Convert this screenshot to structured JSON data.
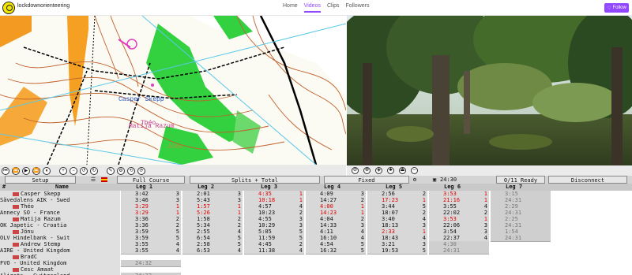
{
  "topbar": {
    "channel": "lockdownorienteering",
    "nav": [
      "Home",
      "Videos",
      "Clips",
      "Followers"
    ],
    "active_nav": "Videos",
    "follow_label": "Follow",
    "accent": "#9147ff"
  },
  "map": {
    "labels": [
      "Casper Skepp",
      "Théo",
      "Matija Razum",
      "Jönu"
    ],
    "controls": [
      "first",
      "rewind",
      "play",
      "fast-forward",
      "pause",
      "zoom-in",
      "zoom-out",
      "rotate-left",
      "rotate-right",
      "pen",
      "settings",
      "refresh",
      "redo"
    ]
  },
  "results": {
    "setup_label": "Setup",
    "course_label": "Full Course",
    "mode_label": "Splits + Total",
    "fixed_label": "Fixed",
    "clock": "24:30",
    "ready_label": "0/11 Ready",
    "disconnect_label": "Disconnect",
    "headers": [
      "#",
      "Name",
      "Leg 1",
      "Leg 2",
      "Leg 3",
      "Leg 4",
      "Leg 5",
      "Leg 6",
      "Leg 7"
    ],
    "rows": [
      {
        "name": "Casper Skepp",
        "flag": true,
        "legs": [
          [
            "3:42",
            "3"
          ],
          [
            "2:01",
            "3"
          ],
          [
            "4:35",
            "1"
          ],
          [
            "4:09",
            "3"
          ],
          [
            "2:56",
            "2"
          ],
          [
            "3:53",
            "1"
          ],
          [
            "3:15",
            ""
          ]
        ],
        "red": [
          2,
          5
        ],
        "grey": [
          6
        ]
      },
      {
        "name": "Sävedalens AIK - Swed",
        "flag": false,
        "legs": [
          [
            "3:46",
            "3"
          ],
          [
            "5:43",
            "3"
          ],
          [
            "10:18",
            "1"
          ],
          [
            "14:27",
            "2"
          ],
          [
            "17:23",
            "1"
          ],
          [
            "21:16",
            "1"
          ],
          [
            "24:31",
            ""
          ]
        ],
        "red": [
          2,
          4,
          5
        ],
        "grey": [
          6
        ]
      },
      {
        "name": "Théo",
        "flag": true,
        "legs": [
          [
            "3:29",
            "1"
          ],
          [
            "1:57",
            "1"
          ],
          [
            "4:57",
            "4"
          ],
          [
            "4:00",
            "1"
          ],
          [
            "3:44",
            "5"
          ],
          [
            "3:55",
            "4"
          ],
          [
            "2:29",
            ""
          ]
        ],
        "red": [
          0,
          1,
          3
        ],
        "grey": [
          6
        ]
      },
      {
        "name": "Annecy SO - France",
        "flag": false,
        "legs": [
          [
            "3:29",
            "1"
          ],
          [
            "5:26",
            "1"
          ],
          [
            "10:23",
            "2"
          ],
          [
            "14:23",
            "1"
          ],
          [
            "18:07",
            "2"
          ],
          [
            "22:02",
            "2"
          ],
          [
            "24:31",
            ""
          ]
        ],
        "red": [
          0,
          1,
          3
        ],
        "grey": [
          6
        ]
      },
      {
        "name": "Matija Razum",
        "flag": true,
        "legs": [
          [
            "3:36",
            "2"
          ],
          [
            "1:58",
            "2"
          ],
          [
            "4:55",
            "3"
          ],
          [
            "4:04",
            "2"
          ],
          [
            "3:40",
            "4"
          ],
          [
            "3:53",
            "1"
          ],
          [
            "2:25",
            ""
          ]
        ],
        "red": [
          5
        ],
        "grey": [
          6
        ]
      },
      {
        "name": "OK Japetic - Croatia",
        "flag": false,
        "legs": [
          [
            "3:36",
            "2"
          ],
          [
            "5:34",
            "2"
          ],
          [
            "10:29",
            "3"
          ],
          [
            "14:33",
            "3"
          ],
          [
            "18:13",
            "3"
          ],
          [
            "22:06",
            "3"
          ],
          [
            "24:31",
            ""
          ]
        ],
        "red": [],
        "grey": [
          6
        ]
      },
      {
        "name": "Jönu",
        "flag": true,
        "legs": [
          [
            "3:59",
            "5"
          ],
          [
            "2:55",
            "4"
          ],
          [
            "5:05",
            "5"
          ],
          [
            "4:11",
            "4"
          ],
          [
            "2:33",
            "1"
          ],
          [
            "3:54",
            "3"
          ],
          [
            "1:54",
            ""
          ]
        ],
        "red": [
          4
        ],
        "grey": [
          6
        ]
      },
      {
        "name": "OLV Hindelbank - Swit",
        "flag": false,
        "legs": [
          [
            "3:59",
            "5"
          ],
          [
            "6:54",
            "5"
          ],
          [
            "11:59",
            "5"
          ],
          [
            "16:10",
            "4"
          ],
          [
            "18:43",
            "4"
          ],
          [
            "22:37",
            "4"
          ],
          [
            "24:31",
            ""
          ]
        ],
        "red": [],
        "grey": [
          6
        ]
      },
      {
        "name": "Andrew Stemp",
        "flag": true,
        "legs": [
          [
            "3:55",
            "4"
          ],
          [
            "2:58",
            "5"
          ],
          [
            "4:45",
            "2"
          ],
          [
            "4:54",
            "5"
          ],
          [
            "3:21",
            "3"
          ],
          [
            "4:30",
            ""
          ]
        ],
        "red": [],
        "grey": [
          5
        ]
      },
      {
        "name": "AIRE - United Kingdom",
        "flag": false,
        "legs": [
          [
            "3:55",
            "4"
          ],
          [
            "6:53",
            "4"
          ],
          [
            "11:38",
            "4"
          ],
          [
            "16:32",
            "5"
          ],
          [
            "19:53",
            "5"
          ],
          [
            "24:31",
            ""
          ]
        ],
        "red": [],
        "grey": [
          5
        ]
      },
      {
        "name": "BradC",
        "flag": true,
        "legs": [],
        "red": [],
        "grey": []
      },
      {
        "name": "FVO - United Kingdom",
        "flag": false,
        "legs": [
          [
            "24:32",
            ""
          ]
        ],
        "red": [],
        "grey": [
          0
        ]
      },
      {
        "name": "Cesc Amaat",
        "flag": true,
        "legs": [],
        "red": [],
        "grey": []
      },
      {
        "name": "Aliqots - Switzerland",
        "flag": false,
        "legs": [
          [
            "24:32",
            ""
          ]
        ],
        "red": [],
        "grey": [
          0
        ]
      }
    ]
  }
}
